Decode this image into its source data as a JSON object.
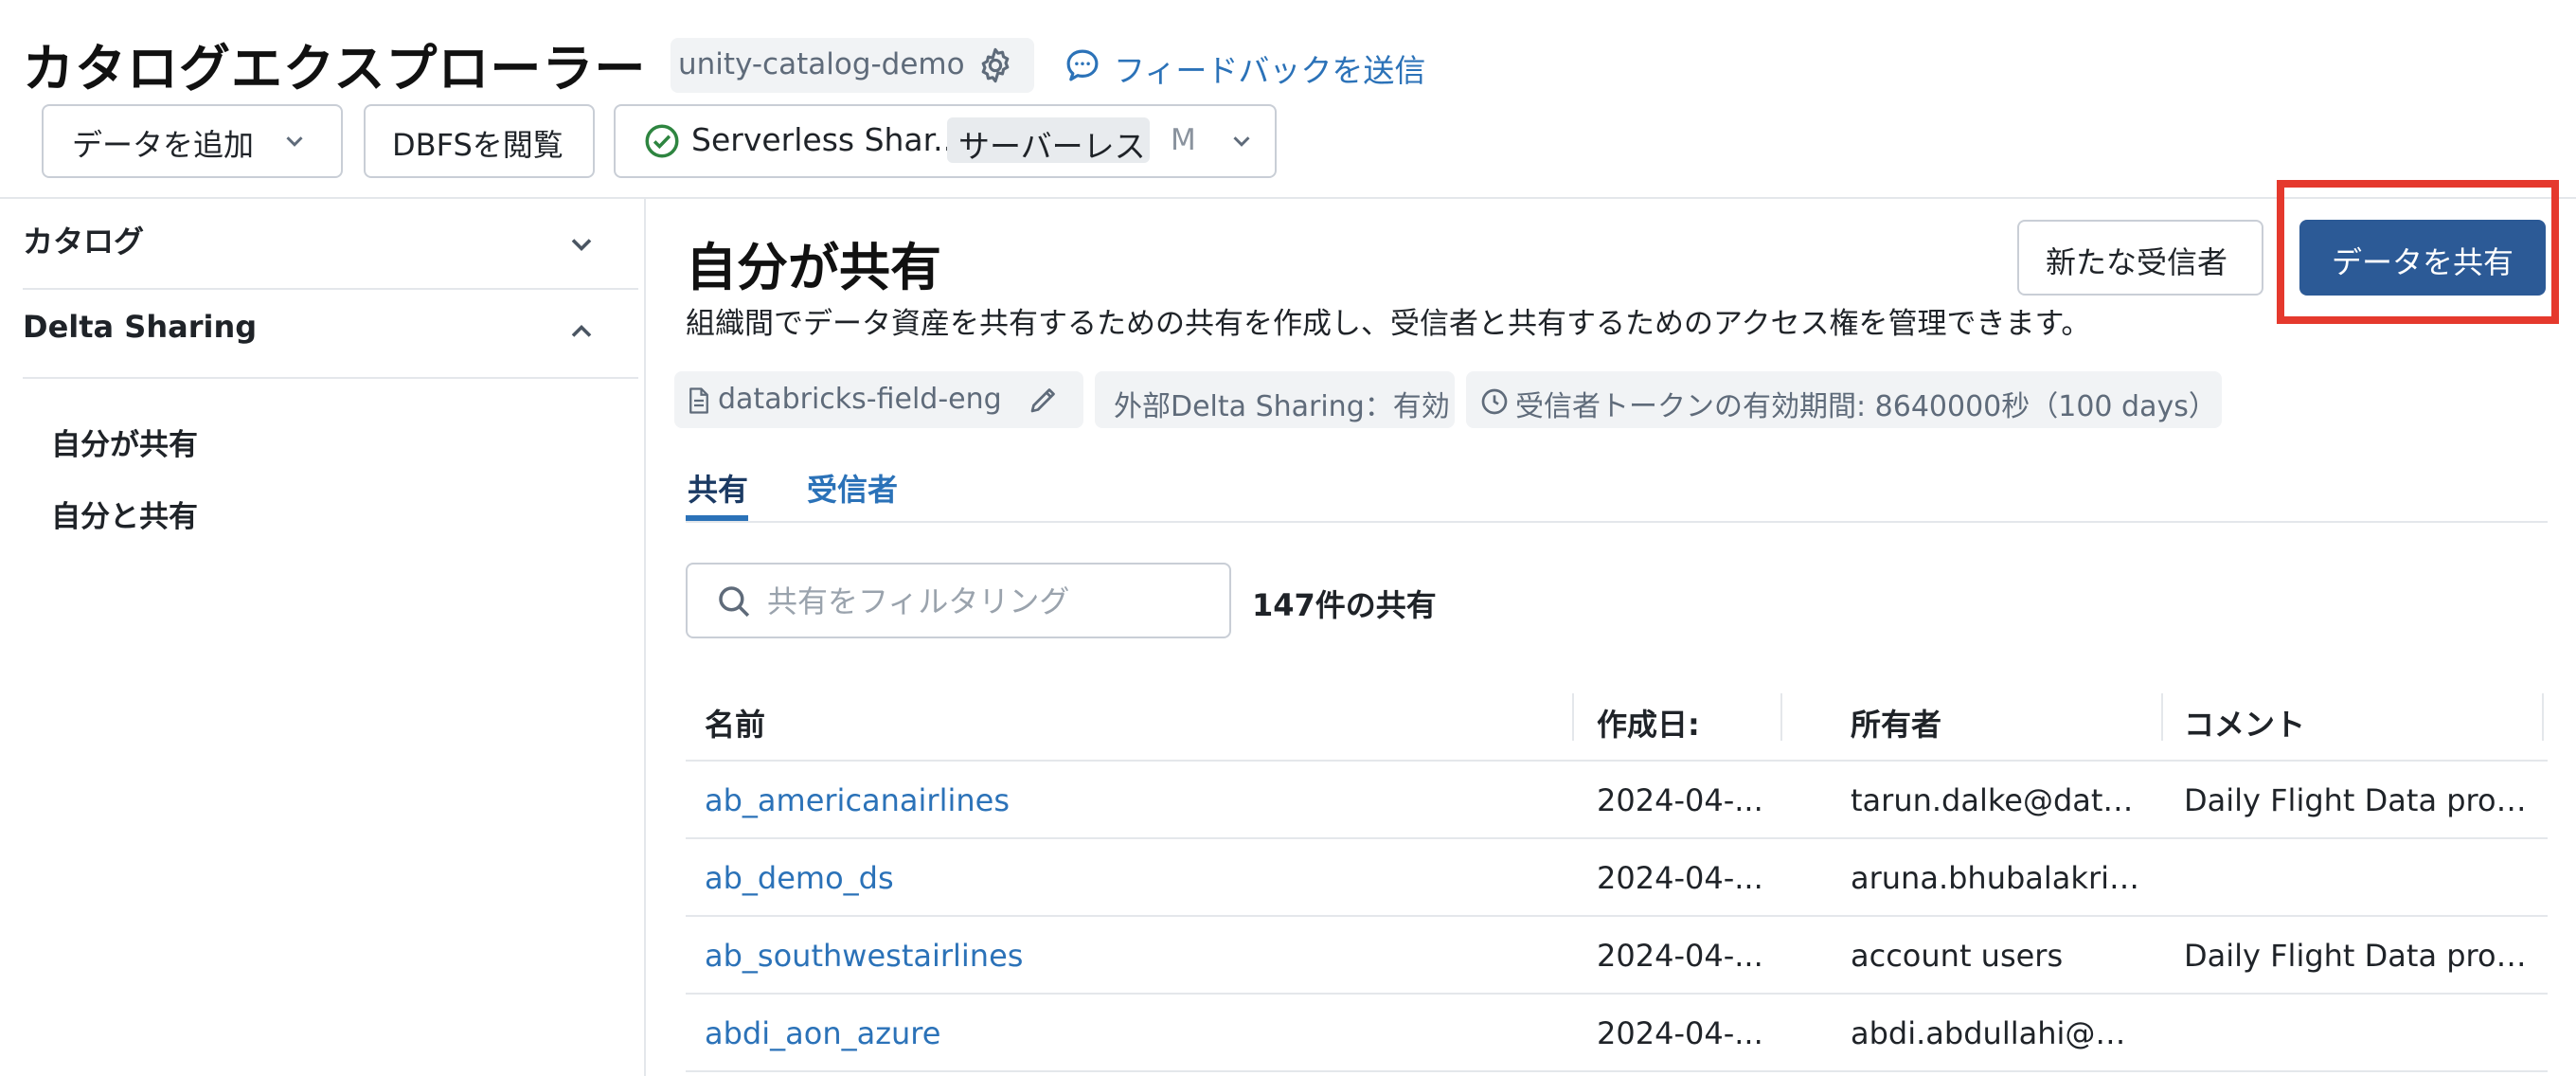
{
  "header": {
    "title": "カタログエクスプローラー",
    "workspace": "unity-catalog-demo",
    "feedback_label": "フィードバックを送信"
  },
  "toolbar": {
    "add_data_label": "データを追加",
    "browse_dbfs_label": "DBFSを閲覧",
    "compute": {
      "name": "Serverless Shar...",
      "badge": "サーバーレス",
      "size": "M",
      "status_color": "#2e8540"
    }
  },
  "sidebar": {
    "sections": [
      {
        "label": "カタログ",
        "expanded": false
      },
      {
        "label": "Delta Sharing",
        "expanded": true
      }
    ],
    "items": [
      {
        "label": "自分が共有"
      },
      {
        "label": "自分と共有"
      }
    ]
  },
  "main": {
    "title": "自分が共有",
    "description": "組織間でデータ資産を共有するための共有を作成し、受信者と共有するためのアクセス権を管理できます。",
    "new_recipient_label": "新たな受信者",
    "share_data_label": "データを共有",
    "accent_color": "#2c5a96",
    "highlight_color": "#e5392d",
    "chips": {
      "metastore": "databricks-field-eng",
      "external_sharing": "外部Delta Sharing：有効",
      "token_lifetime": "受信者トークンの有効期間: 8640000秒（100 days）"
    },
    "tabs": [
      {
        "label": "共有",
        "active": true
      },
      {
        "label": "受信者",
        "active": false
      }
    ],
    "search": {
      "placeholder": "共有をフィルタリング",
      "value": ""
    },
    "share_count": "147件の共有",
    "table": {
      "columns": [
        "名前",
        "作成日:",
        "所有者",
        "コメント"
      ],
      "rows": [
        {
          "name": "ab_americanairlines",
          "created": "2024-04-...",
          "owner": "tarun.dalke@databric...",
          "comment": "Daily Flight Data provi..."
        },
        {
          "name": "ab_demo_ds",
          "created": "2024-04-...",
          "owner": "aruna.bhubalakrishna...",
          "comment": ""
        },
        {
          "name": "ab_southwestairlines",
          "created": "2024-04-...",
          "owner": "account users",
          "comment": "Daily Flight Data provi..."
        },
        {
          "name": "abdi_aon_azure",
          "created": "2024-04-...",
          "owner": "abdi.abdullahi@datab...",
          "comment": ""
        }
      ]
    }
  }
}
